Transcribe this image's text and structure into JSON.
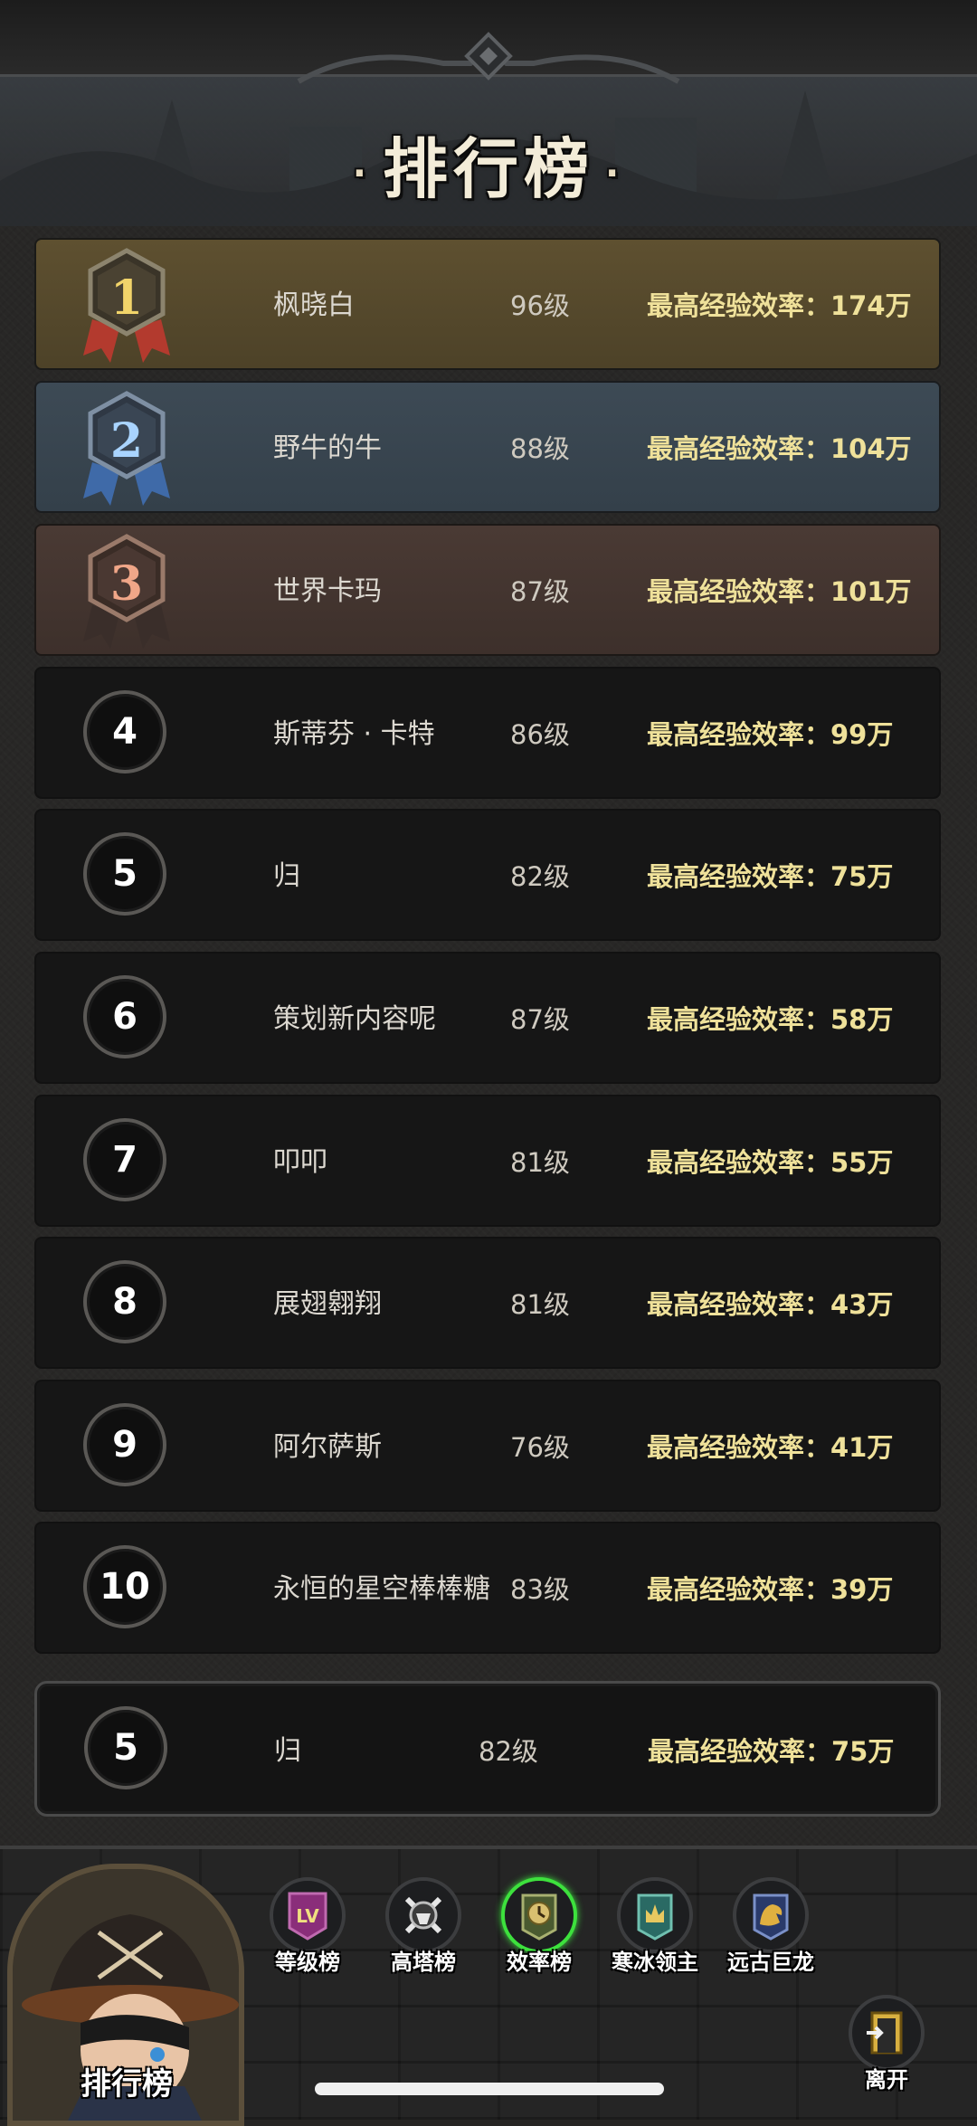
{
  "header": {
    "title": "排行榜",
    "dot": "·"
  },
  "rows": [
    {
      "rank": "1",
      "name": "枫晓白",
      "level": "96级",
      "efficiency": "最高经验效率：174万"
    },
    {
      "rank": "2",
      "name": "野牛的牛",
      "level": "88级",
      "efficiency": "最高经验效率：104万"
    },
    {
      "rank": "3",
      "name": "世界卡玛",
      "level": "87级",
      "efficiency": "最高经验效率：101万"
    },
    {
      "rank": "4",
      "name": "斯蒂芬 · 卡特",
      "level": "86级",
      "efficiency": "最高经验效率：99万"
    },
    {
      "rank": "5",
      "name": "归",
      "level": "82级",
      "efficiency": "最高经验效率：75万"
    },
    {
      "rank": "6",
      "name": "策划新内容呢",
      "level": "87级",
      "efficiency": "最高经验效率：58万"
    },
    {
      "rank": "7",
      "name": "叩叩",
      "level": "81级",
      "efficiency": "最高经验效率：55万"
    },
    {
      "rank": "8",
      "name": "展翅翱翔",
      "level": "81级",
      "efficiency": "最高经验效率：43万"
    },
    {
      "rank": "9",
      "name": "阿尔萨斯",
      "level": "76级",
      "efficiency": "最高经验效率：41万"
    },
    {
      "rank": "10",
      "name": "永恒的星空棒棒糖",
      "level": "83级",
      "efficiency": "最高经验效率：39万"
    }
  ],
  "self": {
    "rank": "5",
    "name": "归",
    "level": "82级",
    "efficiency": "最高经验效率：75万"
  },
  "bottom": {
    "portrait_label": "排行榜",
    "tabs": [
      {
        "label": "等级榜",
        "icon": "lv-icon",
        "icon_text": "LV"
      },
      {
        "label": "高塔榜",
        "icon": "tower-icon"
      },
      {
        "label": "效率榜",
        "icon": "clock-icon",
        "active": true
      },
      {
        "label": "寒冰领主",
        "icon": "ice-lord-icon"
      },
      {
        "label": "远古巨龙",
        "icon": "dragon-icon"
      }
    ],
    "exit_label": "离开"
  },
  "colors": {
    "gold": "#5e5030",
    "silver": "#3d4a55",
    "bronze": "#4a3a34",
    "efficiency_text": "#efe19a",
    "active_tab": "#3de13d"
  }
}
